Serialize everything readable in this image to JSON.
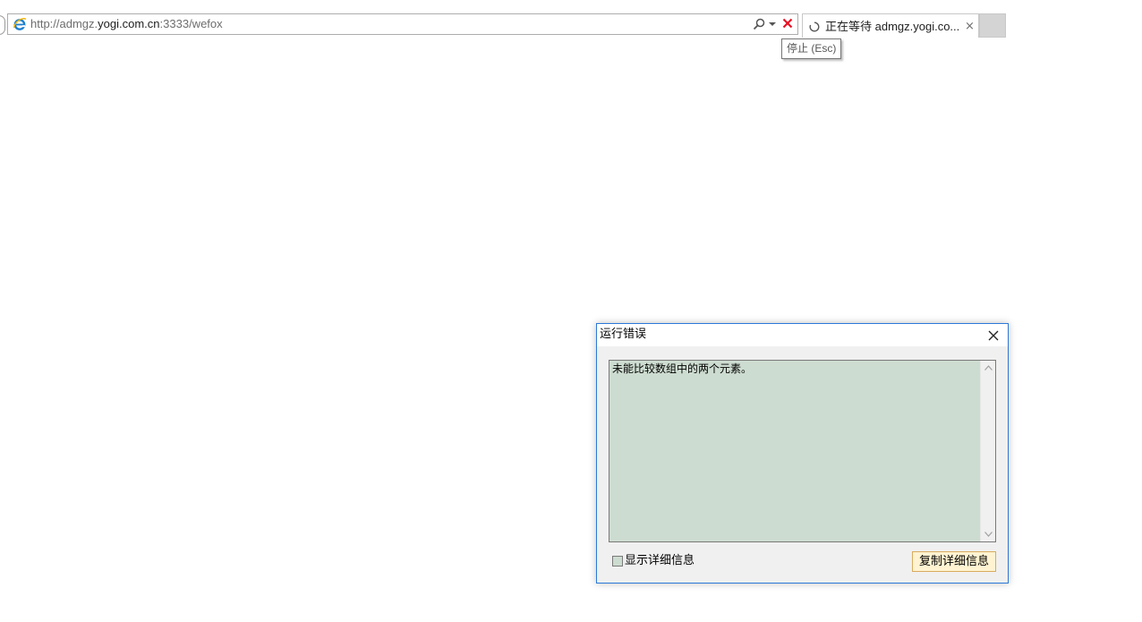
{
  "browser": {
    "address_bar": {
      "url_prefix": "http://admgz.",
      "url_domain": "yogi.com.cn",
      "url_suffix": ":3333/wefox"
    },
    "tab": {
      "title": "正在等待 admgz.yogi.co...",
      "close_glyph": "×"
    },
    "tooltip": "停止 (Esc)"
  },
  "dialog": {
    "title": "运行错误",
    "message": "未能比较数组中的两个元素。",
    "checkbox_label": "显示详细信息",
    "copy_button_label": "复制详细信息"
  },
  "icons": {
    "ie": "ie-logo-icon",
    "search": "search-icon",
    "dropdown": "chevron-down-icon",
    "stop": "stop-icon",
    "spinner": "loading-spinner-icon",
    "close": "close-icon"
  },
  "colors": {
    "stop_red": "#e81123",
    "ie_blue": "#1c7fd0",
    "dialog_border": "#2b79d9",
    "message_bg": "#cddcd0",
    "button_bg": "#fff3d1",
    "button_border": "#d9ac5f"
  }
}
